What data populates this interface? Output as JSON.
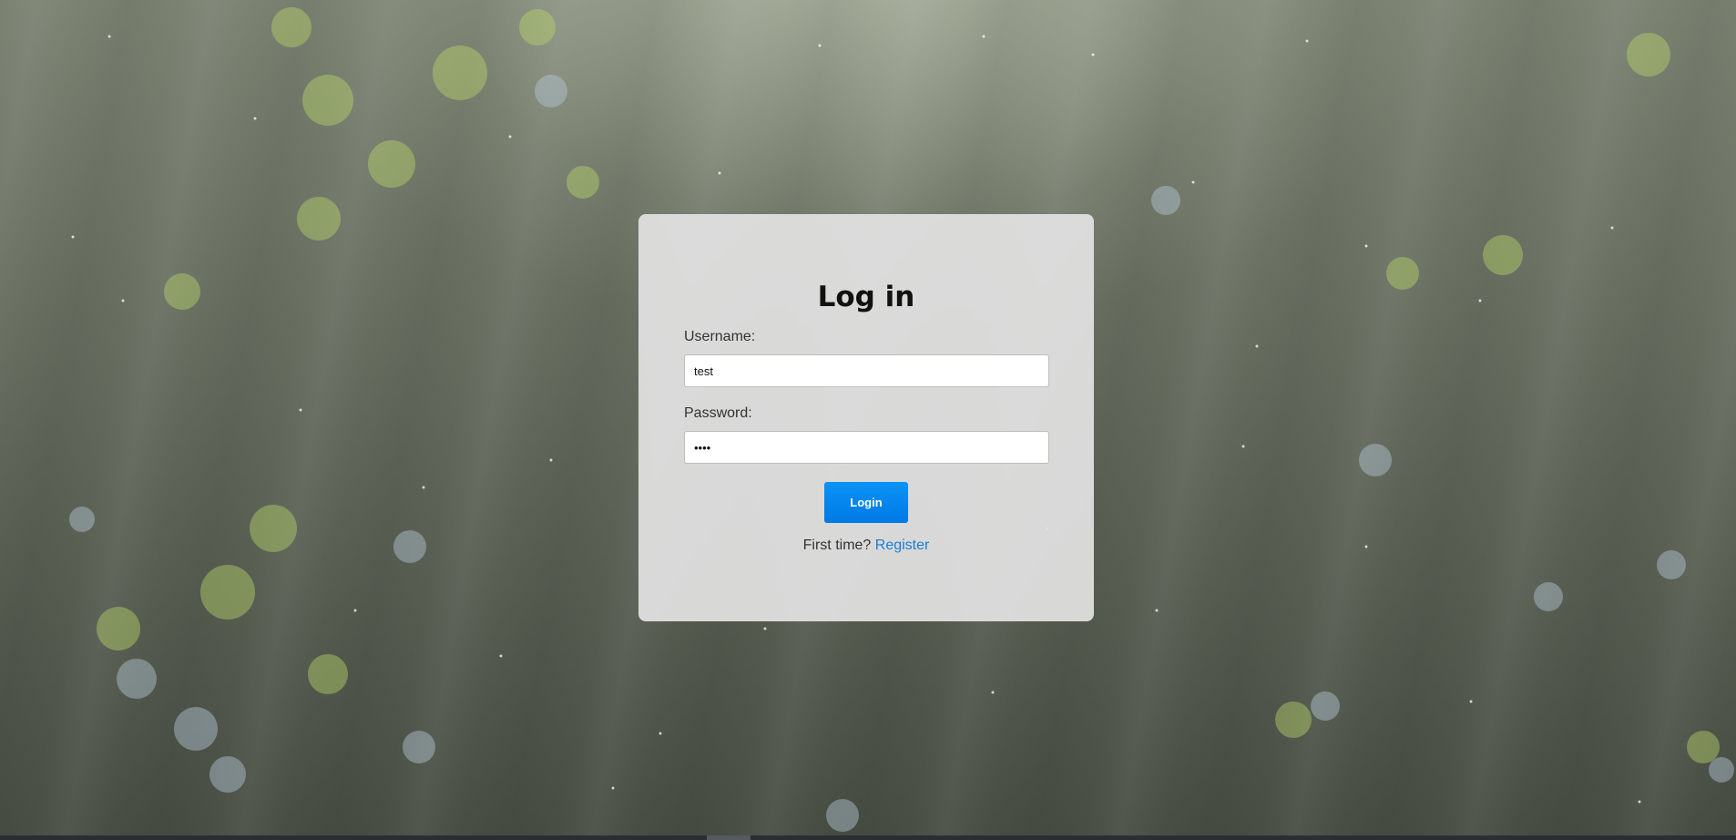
{
  "login": {
    "title": "Log in",
    "username_label": "Username:",
    "username_value": "test",
    "password_label": "Password:",
    "password_value": "test",
    "button_label": "Login",
    "first_time_text": "First time?",
    "register_link": "Register"
  },
  "colors": {
    "button": "#0a86f0",
    "link": "#1a7fd4",
    "card": "#e2e2e2"
  }
}
